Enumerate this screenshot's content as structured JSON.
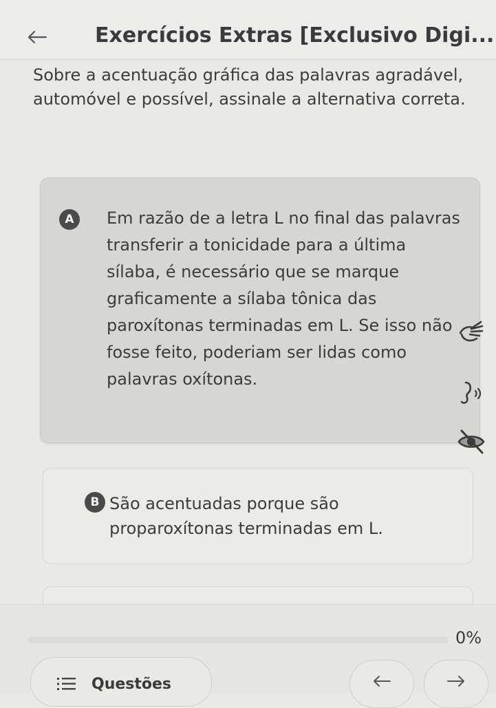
{
  "header": {
    "title": "Exercícios Extras [Exclusivo Digi...",
    "back_icon": "arrow-left-icon"
  },
  "question": {
    "text": "Sobre a acentuação gráfica das palavras agradável, automóvel e possível, assinale a alternativa correta."
  },
  "options": [
    {
      "letter": "A",
      "text": "Em razão de a letra L no final das palavras transferir a tonicidade para a última sílaba, é necessário que se marque graficamente a sílaba tônica das paroxítonas terminadas em L. Se isso não fosse feito, poderiam ser lidas como palavras oxítonas.",
      "selected": true
    },
    {
      "letter": "B",
      "text": "São acentuadas porque são proparoxítonas terminadas em L.",
      "selected": false
    }
  ],
  "side_tools": [
    "sign-language-icon",
    "speaker-icon",
    "eye-slash-icon"
  ],
  "footer": {
    "progress": 0,
    "progress_label": "0%",
    "questions_label": "Questões",
    "questions_icon": "list-icon",
    "prev_icon": "arrow-left-icon",
    "next_icon": "arrow-right-icon"
  },
  "colors": {
    "background": "#e9e9e6",
    "selected_option": "#d6d6d3",
    "badge": "#4a4a4a",
    "text": "#3c3c3c"
  }
}
